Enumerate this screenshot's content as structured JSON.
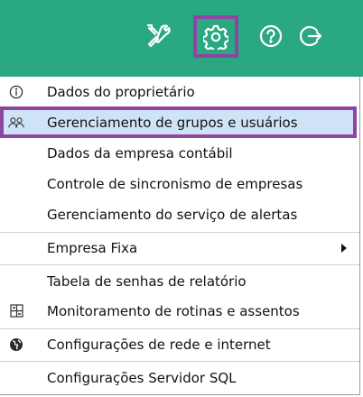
{
  "toolbar": {
    "accent": "#2aa882",
    "buttons": [
      {
        "name": "tools",
        "icon": "tools-icon"
      },
      {
        "name": "settings",
        "icon": "gear-icon"
      },
      {
        "name": "help",
        "icon": "question-circle-icon"
      },
      {
        "name": "logout",
        "icon": "logout-icon"
      }
    ]
  },
  "menu": {
    "highlight_color": "#8e44a2",
    "selected_bg": "#cfe3f7",
    "items": [
      {
        "label": "Dados do proprietário",
        "icon": "info-circle-icon"
      },
      {
        "label": "Gerenciamento de grupos e usuários",
        "icon": "users-icon",
        "selected": true
      },
      {
        "label": "Dados da empresa contábil"
      },
      {
        "label": "Controle de sincronismo de empresas"
      },
      {
        "label": "Gerenciamento do serviço de alertas"
      },
      {
        "label": "Empresa Fixa",
        "icon": "submenu-arrow-icon"
      },
      {
        "label": "Tabela de senhas de relatório"
      },
      {
        "label": "Monitoramento de rotinas e assentos",
        "icon": "monitor-grid-icon"
      },
      {
        "label": "Configurações de rede e internet",
        "icon": "globe-icon"
      },
      {
        "label": "Configurações Servidor SQL"
      }
    ]
  }
}
